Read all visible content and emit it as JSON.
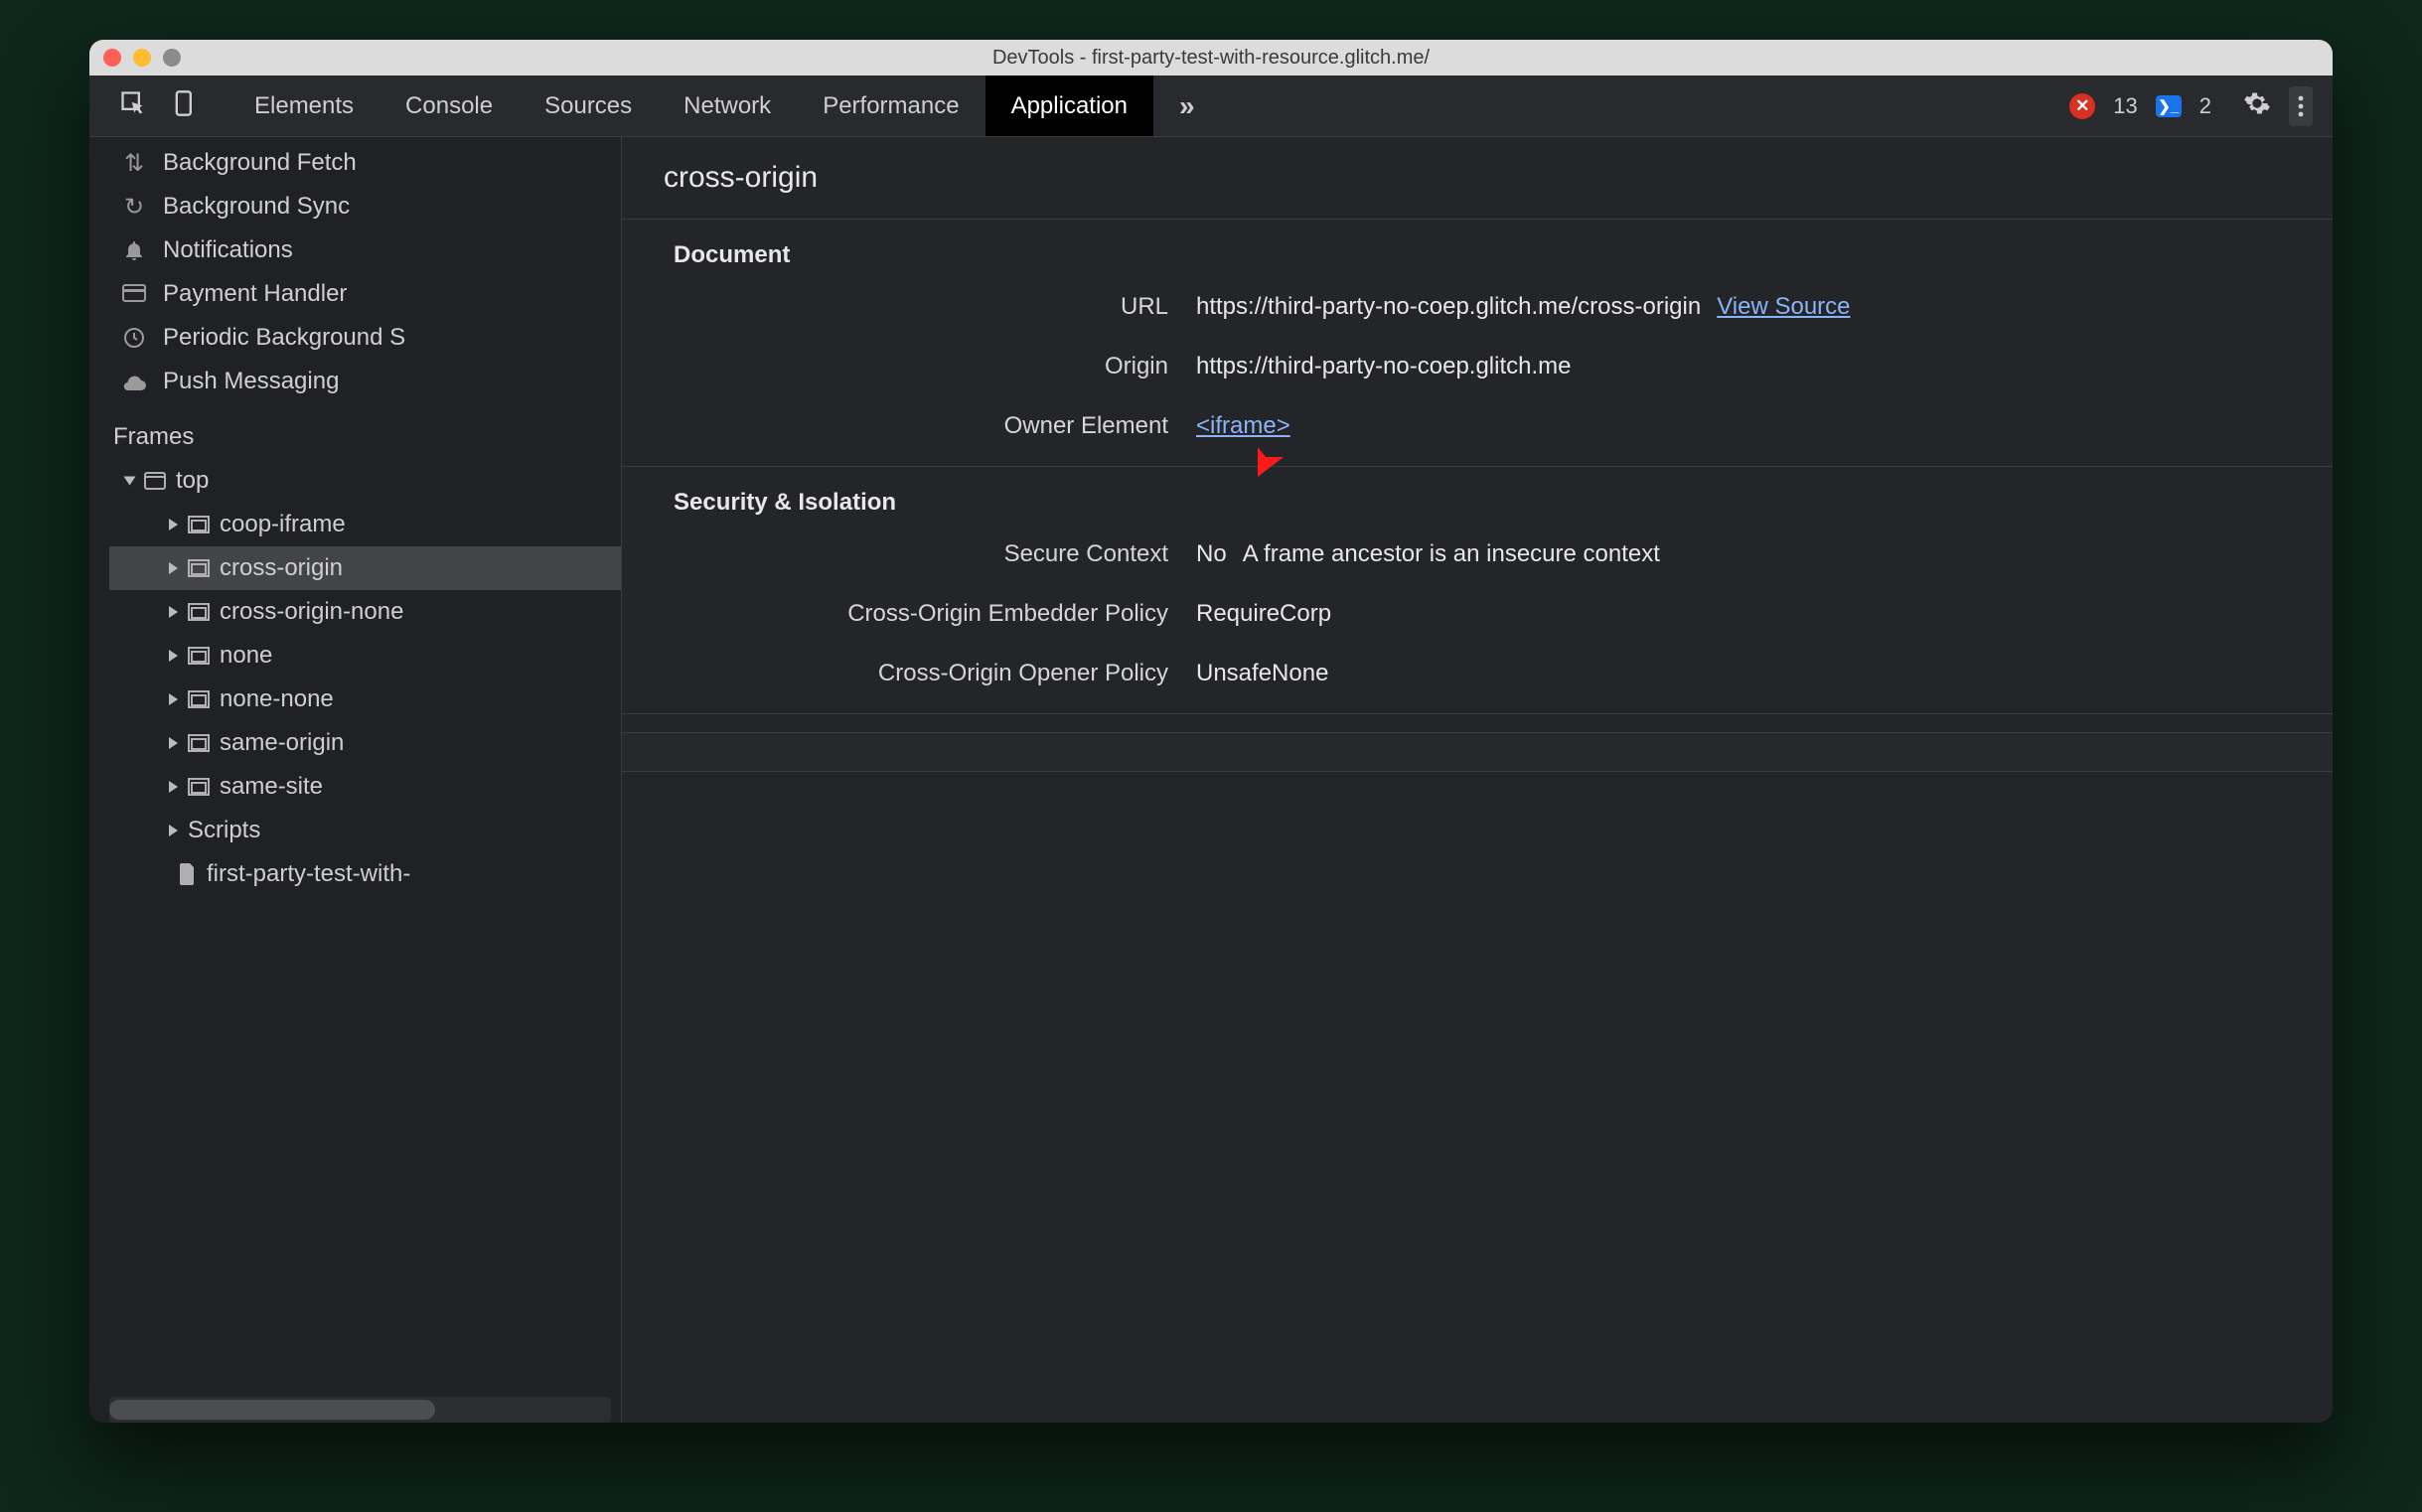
{
  "window": {
    "title": "DevTools - first-party-test-with-resource.glitch.me/"
  },
  "tabs": {
    "items": [
      "Elements",
      "Console",
      "Sources",
      "Network",
      "Performance",
      "Application"
    ],
    "active": "Application",
    "overflow_glyph": "»"
  },
  "toolbar": {
    "error_count": "13",
    "info_count": "2"
  },
  "sidebar": {
    "bg_items": [
      {
        "icon": "background-fetch-icon",
        "label": "Background Fetch"
      },
      {
        "icon": "background-sync-icon",
        "label": "Background Sync"
      },
      {
        "icon": "notifications-icon",
        "label": "Notifications"
      },
      {
        "icon": "payment-handler-icon",
        "label": "Payment Handler"
      },
      {
        "icon": "periodic-bg-sync-icon",
        "label": "Periodic Background S"
      },
      {
        "icon": "push-messaging-icon",
        "label": "Push Messaging"
      }
    ],
    "frames_title": "Frames",
    "tree": {
      "top": "top",
      "children": [
        "coop-iframe",
        "cross-origin",
        "cross-origin-none",
        "none",
        "none-none",
        "same-origin",
        "same-site"
      ],
      "scripts_label": "Scripts",
      "script_item": "first-party-test-with-",
      "selected": "cross-origin"
    }
  },
  "main": {
    "title": "cross-origin",
    "document": {
      "heading": "Document",
      "url_label": "URL",
      "url_value": "https://third-party-no-coep.glitch.me/cross-origin",
      "view_source": "View Source",
      "origin_label": "Origin",
      "origin_value": "https://third-party-no-coep.glitch.me",
      "owner_label": "Owner Element",
      "owner_value": "<iframe>"
    },
    "security": {
      "heading": "Security & Isolation",
      "rows": [
        {
          "k": "Secure Context",
          "v": "No",
          "extra": "A frame ancestor is an insecure context"
        },
        {
          "k": "Cross-Origin Embedder Policy",
          "v": "RequireCorp"
        },
        {
          "k": "Cross-Origin Opener Policy",
          "v": "UnsafeNone"
        }
      ]
    }
  }
}
